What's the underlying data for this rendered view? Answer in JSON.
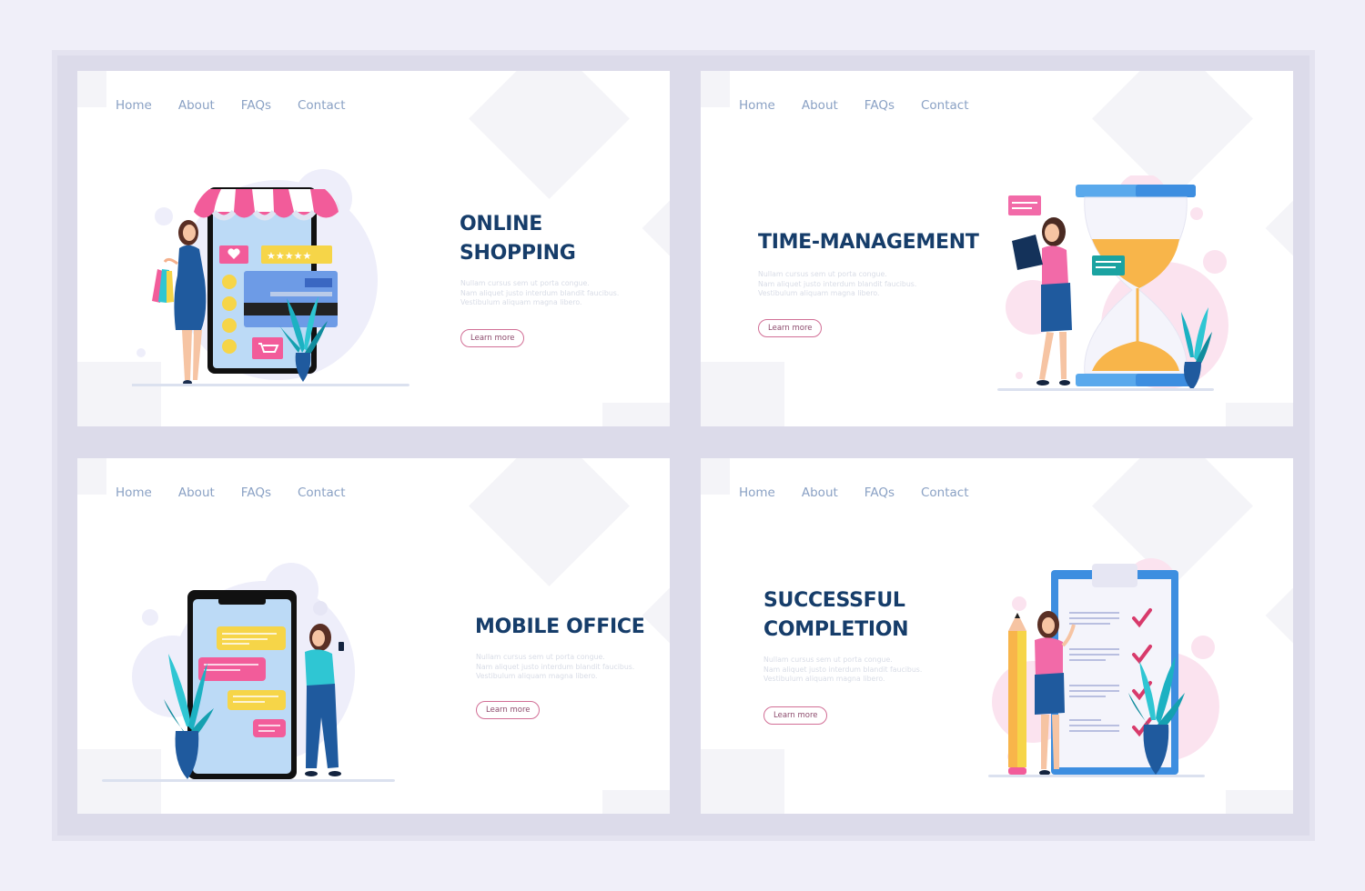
{
  "nav": [
    "Home",
    "About",
    "FAQs",
    "Contact"
  ],
  "colors": {
    "page_bg": "#f0eff9",
    "title": "#163d6a",
    "nav_link": "#8aa1c4",
    "button_border": "#d26f96",
    "pink": "#f25c9a",
    "blue": "#1f5a9e",
    "yellow": "#f5d54a",
    "teal": "#2fc6d3"
  },
  "cards": [
    {
      "id": "online-shopping",
      "title_lines": [
        "ONLINE",
        "SHOPPING"
      ],
      "lorem": [
        "Nullam cursus sem ut porta congue.",
        "Nam aliquet justo interdum blandit faucibus.",
        "Vestibulum aliquam magna libero."
      ],
      "button": "Learn more",
      "illustration": "woman with shopping bags next to tablet storefront with awning, credit card, rating stars and plant"
    },
    {
      "id": "time-management",
      "title_lines": [
        "TIME-MANAGEMENT"
      ],
      "lorem": [
        "Nullam cursus sem ut porta congue.",
        "Nam aliquet justo interdum blandit faucibus.",
        "Vestibulum aliquam magna libero."
      ],
      "button": "Learn more",
      "illustration": "woman holding laptop next to giant hourglass, chat bubbles and plant"
    },
    {
      "id": "mobile-office",
      "title_lines": [
        "MOBILE OFFICE"
      ],
      "lorem": [
        "Nullam cursus sem ut porta congue.",
        "Nam aliquet justo interdum blandit faucibus.",
        "Vestibulum aliquam magna libero."
      ],
      "button": "Learn more",
      "illustration": "woman with phone leaning on giant smartphone with chat messages and plant"
    },
    {
      "id": "successful-completion",
      "title_lines": [
        "SUCCESSFUL",
        "COMPLETION"
      ],
      "lorem": [
        "Nullam cursus sem ut porta congue.",
        "Nam aliquet justo interdum blandit faucibus.",
        "Vestibulum aliquam magna libero."
      ],
      "button": "Learn more",
      "illustration": "woman with giant pencil next to clipboard checklist with checkmarks and plant"
    }
  ]
}
